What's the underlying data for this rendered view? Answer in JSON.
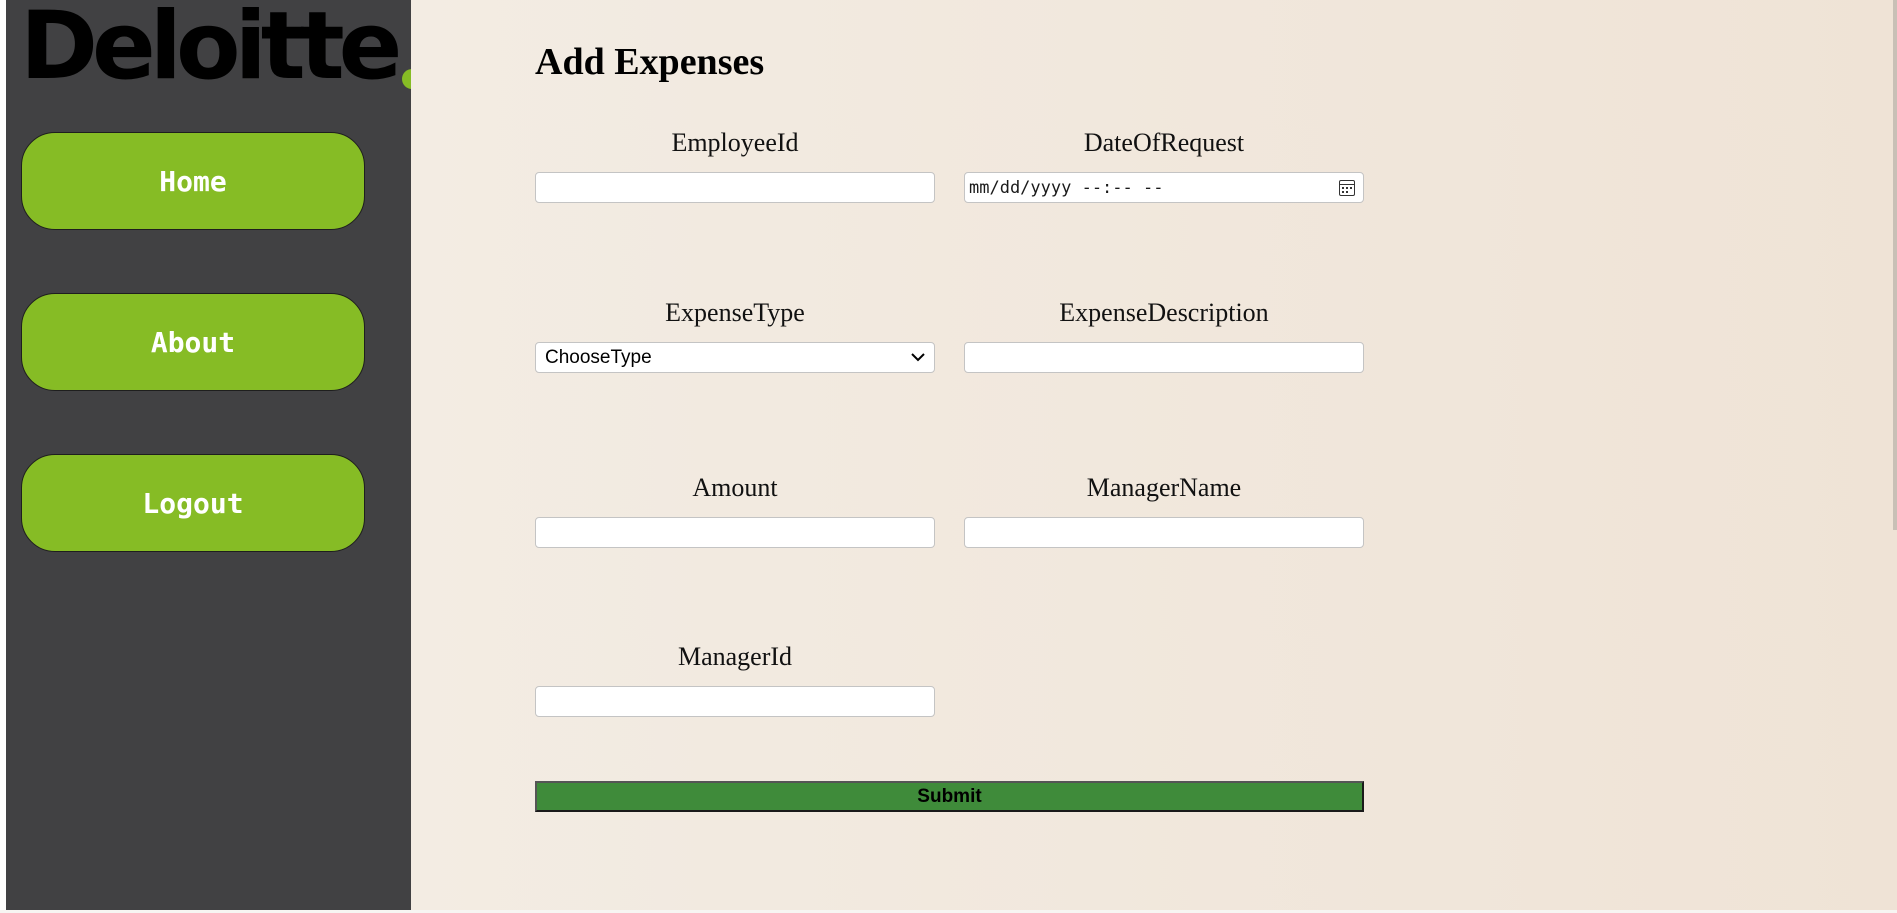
{
  "sidebar": {
    "logo_text": "Deloitte",
    "brand_color": "#86bc25",
    "nav": [
      {
        "label": "Home"
      },
      {
        "label": "About"
      },
      {
        "label": "Logout"
      }
    ]
  },
  "main": {
    "title": "Add Expenses",
    "fields": {
      "employee_id": {
        "label": "EmployeeId",
        "value": ""
      },
      "date_of_request": {
        "label": "DateOfRequest",
        "placeholder": "mm/dd/yyyy --:-- --",
        "icon": "calendar-icon"
      },
      "expense_type": {
        "label": "ExpenseType",
        "selected": "ChooseType",
        "icon": "chevron-down-icon"
      },
      "expense_description": {
        "label": "ExpenseDescription",
        "value": ""
      },
      "amount": {
        "label": "Amount",
        "value": ""
      },
      "manager_name": {
        "label": "ManagerName",
        "value": ""
      },
      "manager_id": {
        "label": "ManagerId",
        "value": ""
      }
    },
    "submit_label": "Submit",
    "submit_color": "#3f8b3a"
  }
}
